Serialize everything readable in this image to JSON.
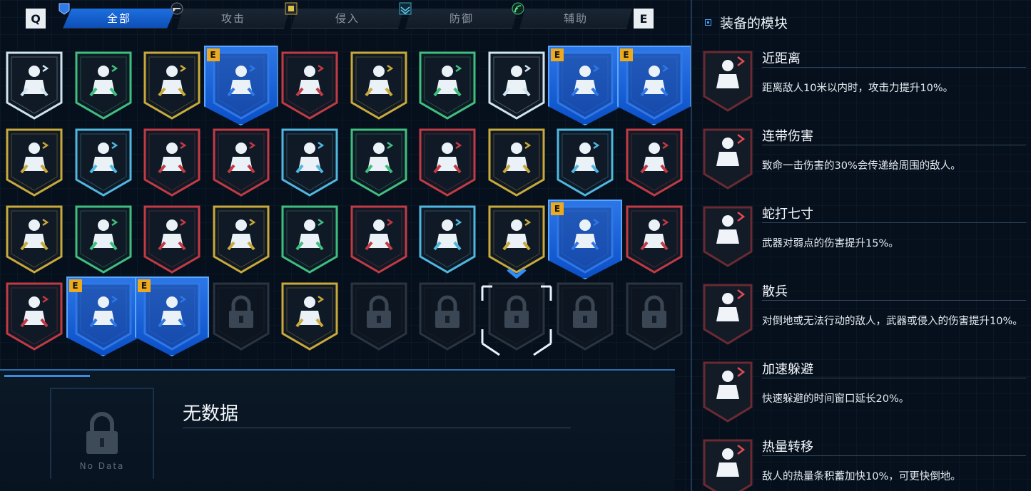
{
  "tabs": {
    "prev_key": "Q",
    "next_key": "E",
    "items": [
      {
        "label": "全部",
        "icon": "category-all-icon",
        "active": true
      },
      {
        "label": "攻击",
        "icon": "gun-icon",
        "active": false
      },
      {
        "label": "侵入",
        "icon": "chip-icon",
        "active": false
      },
      {
        "label": "防御",
        "icon": "shield-wave-icon",
        "active": false
      },
      {
        "label": "辅助",
        "icon": "signal-icon",
        "active": false
      }
    ]
  },
  "grid": {
    "equipped_badge": "E",
    "modules": [
      {
        "icon": "heart-plus-icon",
        "color": "#cfe3f0",
        "equipped": false
      },
      {
        "icon": "ammo-box-icon",
        "color": "#3fbf7f",
        "equipped": false
      },
      {
        "icon": "time-figure-icon",
        "color": "#c9a93a",
        "equipped": false
      },
      {
        "icon": "close-combat-icon",
        "color": "#2f78e6",
        "equipped": true
      },
      {
        "icon": "target-crosshair-icon",
        "color": "#c23a44",
        "equipped": false
      },
      {
        "icon": "hand-figure-icon",
        "color": "#c9a93a",
        "equipped": false
      },
      {
        "icon": "swap-arrows-icon",
        "color": "#3fbf7f",
        "equipped": false
      },
      {
        "icon": "soldier-shield-icon",
        "color": "#cfe3f0",
        "equipped": false
      },
      {
        "icon": "chain-damage-icon",
        "color": "#2f78e6",
        "equipped": true
      },
      {
        "icon": "scatter-soldier-icon",
        "color": "#2f78e6",
        "equipped": true
      },
      {
        "icon": "ring-icon",
        "color": "#c9a93a",
        "equipped": false
      },
      {
        "icon": "soldier-aim-icon",
        "color": "#4fb7e0",
        "equipped": false
      },
      {
        "icon": "melee-figures-icon",
        "color": "#c23a44",
        "equipped": false
      },
      {
        "icon": "soldier-fire-icon",
        "color": "#c23a44",
        "equipped": false
      },
      {
        "icon": "soldier-heal-icon",
        "color": "#4fb7e0",
        "equipped": false
      },
      {
        "icon": "board-shield-icon",
        "color": "#3fbf7f",
        "equipped": false
      },
      {
        "icon": "explosion-crouch-icon",
        "color": "#c23a44",
        "equipped": false
      },
      {
        "icon": "grid-cubes-icon",
        "color": "#c9a93a",
        "equipped": false
      },
      {
        "icon": "leap-heart-icon",
        "color": "#4fb7e0",
        "equipped": false
      },
      {
        "icon": "gun-grid-icon",
        "color": "#c23a44",
        "equipped": false
      },
      {
        "icon": "gun-tiles-icon",
        "color": "#c9a93a",
        "equipped": false
      },
      {
        "icon": "throw-figure-icon",
        "color": "#3fbf7f",
        "equipped": false
      },
      {
        "icon": "kick-figure-icon",
        "color": "#c23a44",
        "equipped": false
      },
      {
        "icon": "jetpack-icon",
        "color": "#c9a93a",
        "equipped": false
      },
      {
        "icon": "revolver-icon",
        "color": "#3fbf7f",
        "equipped": false
      },
      {
        "icon": "bullet-ring-icon",
        "color": "#c23a44",
        "equipped": false
      },
      {
        "icon": "flex-arm-icon",
        "color": "#4fb7e0",
        "equipped": false
      },
      {
        "icon": "arms-crossed-icon",
        "color": "#c9a93a",
        "equipped": false
      },
      {
        "icon": "heat-transfer-icon",
        "color": "#2f78e6",
        "equipped": true
      },
      {
        "icon": "gunner-icon",
        "color": "#c23a44",
        "equipped": false
      },
      {
        "icon": "flex-figure-icon",
        "color": "#c23a44",
        "equipped": false
      },
      {
        "icon": "dodge-time-icon",
        "color": "#2f78e6",
        "equipped": true
      },
      {
        "icon": "weakpoint-icon",
        "color": "#2f78e6",
        "equipped": true
      },
      {
        "icon": "lock-icon",
        "color": "#3a4654",
        "equipped": false,
        "locked": true
      },
      {
        "icon": "bullet-reload-icon",
        "color": "#c9a93a",
        "equipped": false
      },
      {
        "icon": "lock-icon",
        "color": "#3a4654",
        "equipped": false,
        "locked": true
      },
      {
        "icon": "lock-icon",
        "color": "#3a4654",
        "equipped": false,
        "locked": true
      },
      {
        "icon": "lock-icon",
        "color": "#3a4654",
        "equipped": false,
        "locked": true,
        "cursor": true
      },
      {
        "icon": "lock-icon",
        "color": "#3a4654",
        "equipped": false,
        "locked": true
      },
      {
        "icon": "lock-icon",
        "color": "#3a4654",
        "equipped": false,
        "locked": true
      }
    ]
  },
  "detail": {
    "title": "无数据",
    "lock_label": "No Data"
  },
  "equipped": {
    "header": "装备的模块",
    "items": [
      {
        "name": "近距离",
        "desc": "距离敌人10米以内时，攻击力提升10%。",
        "icon": "close-combat-icon"
      },
      {
        "name": "连带伤害",
        "desc": "致命一击伤害的30%会传递给周围的敌人。",
        "icon": "chain-damage-icon"
      },
      {
        "name": "蛇打七寸",
        "desc": "武器对弱点的伤害提升15%。",
        "icon": "weakpoint-icon"
      },
      {
        "name": "散兵",
        "desc": "对倒地或无法行动的敌人，武器或侵入的伤害提升10%。",
        "icon": "scatter-soldier-icon"
      },
      {
        "name": "加速躲避",
        "desc": "快速躲避的时间窗口延长20%。",
        "icon": "dodge-time-icon"
      },
      {
        "name": "热量转移",
        "desc": "敌人的热量条积蓄加快10%，可更快倒地。",
        "icon": "heat-transfer-icon"
      }
    ]
  }
}
